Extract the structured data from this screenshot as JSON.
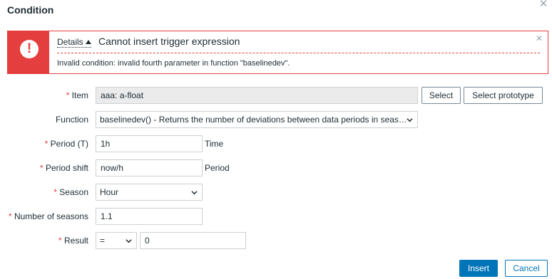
{
  "dialog": {
    "title": "Condition",
    "close_icon": "close-icon"
  },
  "alert": {
    "details_label": "Details",
    "title": "Cannot insert trigger expression",
    "message": "Invalid condition: invalid fourth parameter in function \"baselinedev\".",
    "icon": "exclamation-icon",
    "accent": "#e53e3e"
  },
  "form": {
    "required_mark": "*",
    "item": {
      "label": "Item",
      "value": "aaa: a-float",
      "select_button": "Select",
      "select_prototype_button": "Select prototype"
    },
    "function": {
      "label": "Function",
      "value": "baselinedev() - Returns the number of deviations between data periods in seas…"
    },
    "period": {
      "label": "Period (T)",
      "value": "1h",
      "suffix": "Time"
    },
    "period_shift": {
      "label": "Period shift",
      "value": "now/h",
      "suffix": "Period"
    },
    "season": {
      "label": "Season",
      "value": "Hour"
    },
    "number_of_seasons": {
      "label": "Number of seasons",
      "value": "1.1"
    },
    "result": {
      "label": "Result",
      "operator": "=",
      "value": "0"
    }
  },
  "footer": {
    "insert_button": "Insert",
    "cancel_button": "Cancel"
  },
  "colors": {
    "primary": "#0275b8",
    "error": "#e53e3e"
  }
}
